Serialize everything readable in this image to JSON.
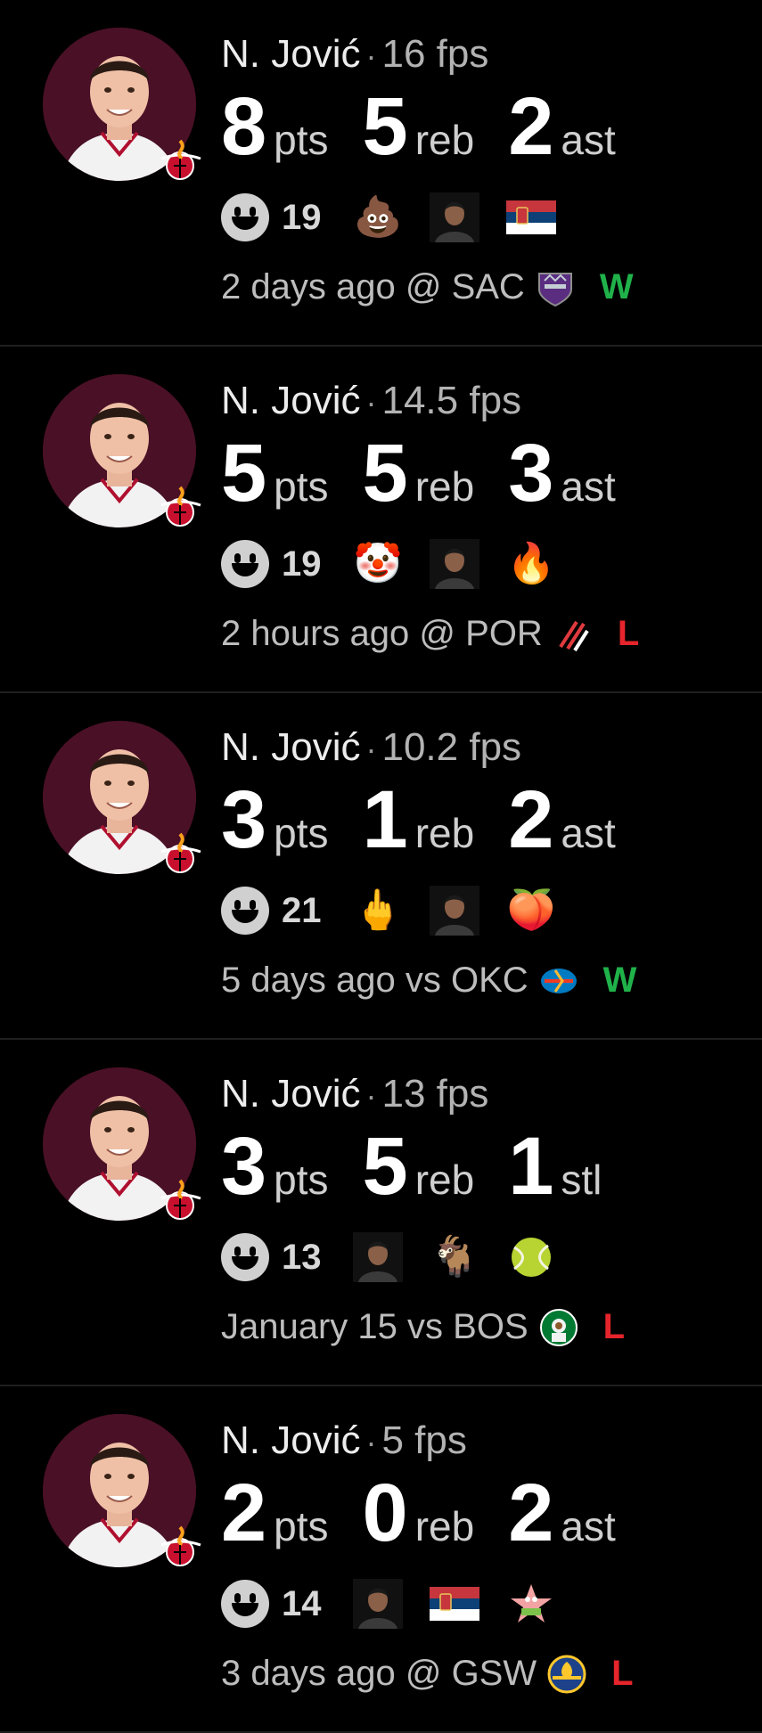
{
  "colors": {
    "win": "#20b24a",
    "loss": "#e5242b",
    "avatar_bg": "#4a1026"
  },
  "cards": [
    {
      "name": "N. Jović",
      "separator": "·",
      "fps": "16 fps",
      "stats": [
        {
          "value": "8",
          "unit": "pts"
        },
        {
          "value": "5",
          "unit": "reb"
        },
        {
          "value": "2",
          "unit": "ast"
        }
      ],
      "reaction_count": "19",
      "reactions": [
        "poop-emoji",
        "person-photo",
        "serbia-flag"
      ],
      "when": "2 days ago",
      "venue": "@",
      "opponent": "SAC",
      "opponent_logo": "kings-logo",
      "result": "W"
    },
    {
      "name": "N. Jović",
      "separator": "·",
      "fps": "14.5 fps",
      "stats": [
        {
          "value": "5",
          "unit": "pts"
        },
        {
          "value": "5",
          "unit": "reb"
        },
        {
          "value": "3",
          "unit": "ast"
        }
      ],
      "reaction_count": "19",
      "reactions": [
        "clown-emoji",
        "person-photo",
        "fire-emoji"
      ],
      "when": "2 hours ago",
      "venue": "@",
      "opponent": "POR",
      "opponent_logo": "blazers-logo",
      "result": "L"
    },
    {
      "name": "N. Jović",
      "separator": "·",
      "fps": "10.2 fps",
      "stats": [
        {
          "value": "3",
          "unit": "pts"
        },
        {
          "value": "1",
          "unit": "reb"
        },
        {
          "value": "2",
          "unit": "ast"
        }
      ],
      "reaction_count": "21",
      "reactions": [
        "middle-finger-emoji",
        "person-photo",
        "peach-emoji"
      ],
      "when": "5 days ago",
      "venue": "vs",
      "opponent": "OKC",
      "opponent_logo": "thunder-logo",
      "result": "W"
    },
    {
      "name": "N. Jović",
      "separator": "·",
      "fps": "13 fps",
      "stats": [
        {
          "value": "3",
          "unit": "pts"
        },
        {
          "value": "5",
          "unit": "reb"
        },
        {
          "value": "1",
          "unit": "stl"
        }
      ],
      "reaction_count": "13",
      "reactions": [
        "person-photo",
        "goat-emoji",
        "tennis-ball-emoji"
      ],
      "when": "January 15",
      "venue": "vs",
      "opponent": "BOS",
      "opponent_logo": "celtics-logo",
      "result": "L"
    },
    {
      "name": "N. Jović",
      "separator": "·",
      "fps": "5 fps",
      "stats": [
        {
          "value": "2",
          "unit": "pts"
        },
        {
          "value": "0",
          "unit": "reb"
        },
        {
          "value": "2",
          "unit": "ast"
        }
      ],
      "reaction_count": "14",
      "reactions": [
        "person-photo",
        "serbia-flag",
        "cartoon-starfish"
      ],
      "when": "3 days ago",
      "venue": "@",
      "opponent": "GSW",
      "opponent_logo": "warriors-logo",
      "result": "L"
    }
  ]
}
